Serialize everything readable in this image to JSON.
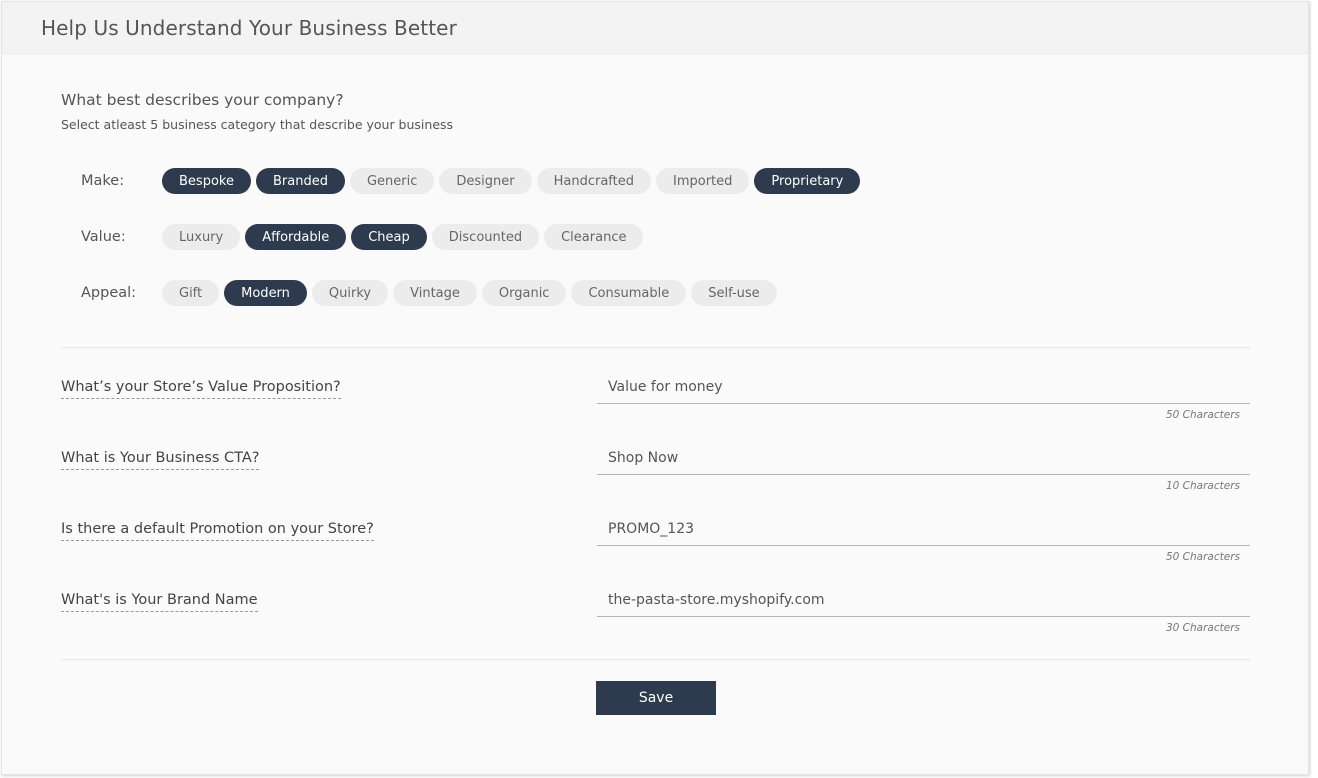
{
  "header": {
    "title": "Help Us Understand Your Business Better"
  },
  "category_section": {
    "question": "What best describes your company?",
    "subtitle": "Select atleast 5 business category that describe your business",
    "rows": [
      {
        "label": "Make:",
        "chips": [
          {
            "label": "Bespoke",
            "selected": true
          },
          {
            "label": "Branded",
            "selected": true
          },
          {
            "label": "Generic",
            "selected": false
          },
          {
            "label": "Designer",
            "selected": false
          },
          {
            "label": "Handcrafted",
            "selected": false
          },
          {
            "label": "Imported",
            "selected": false
          },
          {
            "label": "Proprietary",
            "selected": true
          }
        ]
      },
      {
        "label": "Value:",
        "chips": [
          {
            "label": "Luxury",
            "selected": false
          },
          {
            "label": "Affordable",
            "selected": true
          },
          {
            "label": "Cheap",
            "selected": true
          },
          {
            "label": "Discounted",
            "selected": false
          },
          {
            "label": "Clearance",
            "selected": false
          }
        ]
      },
      {
        "label": "Appeal:",
        "chips": [
          {
            "label": "Gift",
            "selected": false
          },
          {
            "label": "Modern",
            "selected": true
          },
          {
            "label": "Quirky",
            "selected": false
          },
          {
            "label": "Vintage",
            "selected": false
          },
          {
            "label": "Organic",
            "selected": false
          },
          {
            "label": "Consumable",
            "selected": false
          },
          {
            "label": "Self-use",
            "selected": false
          }
        ]
      }
    ]
  },
  "fields": [
    {
      "label": "What’s your Store’s Value Proposition?",
      "value": "Value for money",
      "limit": "50 Characters"
    },
    {
      "label": "What is Your Business CTA?",
      "value": "Shop Now",
      "limit": "10 Characters"
    },
    {
      "label": "Is there a default Promotion on your Store?",
      "value": "PROMO_123",
      "limit": "50 Characters"
    },
    {
      "label": "What's is Your Brand Name",
      "value": "the-pasta-store.myshopify.com",
      "limit": "30 Characters"
    }
  ],
  "actions": {
    "save_label": "Save"
  },
  "colors": {
    "selected_chip": "#2e3b4e",
    "unselected_chip": "#ececec",
    "button": "#2e3b4e"
  }
}
